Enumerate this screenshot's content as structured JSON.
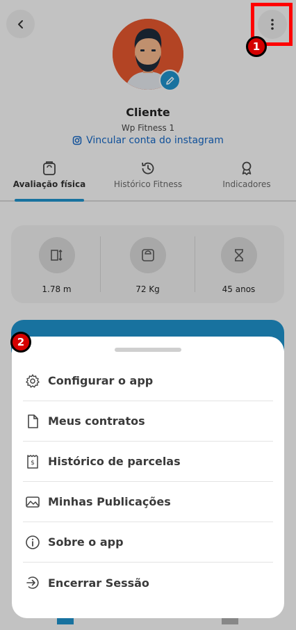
{
  "profile": {
    "name": "Cliente",
    "gym": "Wp Fitness 1",
    "instagram_link": "Vincular conta do instagram"
  },
  "tabs": [
    {
      "label": "Avaliação física",
      "icon": "scale-icon",
      "active": true
    },
    {
      "label": "Histórico Fitness",
      "icon": "history-icon",
      "active": false
    },
    {
      "label": "Indicadores",
      "icon": "award-icon",
      "active": false
    }
  ],
  "stats": [
    {
      "value": "1.78 m",
      "icon": "height-icon"
    },
    {
      "value": "72 Kg",
      "icon": "weight-scale-icon"
    },
    {
      "value": "45 anos",
      "icon": "hourglass-icon"
    }
  ],
  "annotations": {
    "badge_1": "1",
    "badge_2": "2"
  },
  "menu": {
    "items": [
      {
        "label": "Configurar o app",
        "icon": "gear-icon"
      },
      {
        "label": "Meus contratos",
        "icon": "document-icon"
      },
      {
        "label": "Histórico de parcelas",
        "icon": "receipt-icon"
      },
      {
        "label": "Minhas Publicações",
        "icon": "image-icon"
      },
      {
        "label": "Sobre o app",
        "icon": "info-icon"
      },
      {
        "label": "Encerrar Sessão",
        "icon": "logout-icon"
      }
    ]
  },
  "colors": {
    "accent": "#1f8fc7",
    "annotation_red": "#ff0000",
    "link": "#1565c0"
  }
}
